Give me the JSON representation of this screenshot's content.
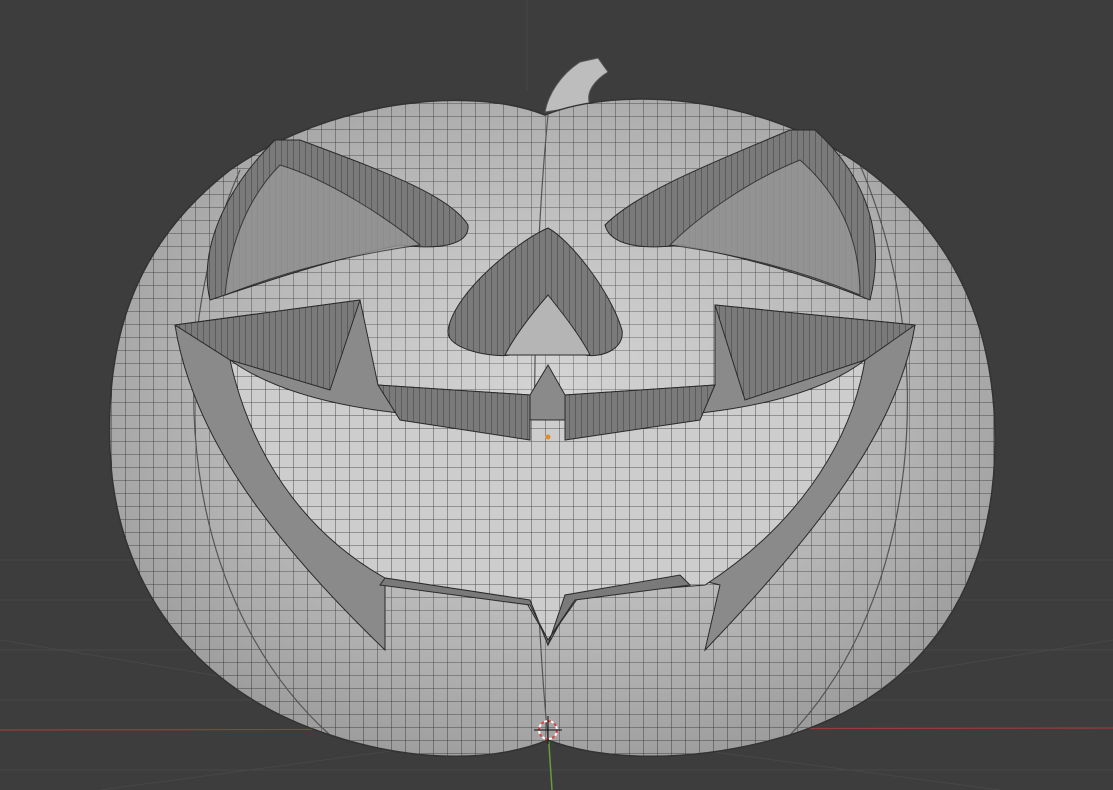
{
  "viewport": {
    "background_color": "#3d3d3d",
    "x_axis_color": "#9a3c3c",
    "y_axis_color": "#6a9a3a",
    "mesh_color": "#cfcfcf",
    "wire_color": "#2a2a2a",
    "cutout_color": "#6e6e6e",
    "object": "pumpkin-mesh",
    "cursor_icon": "3d-cursor-icon"
  }
}
